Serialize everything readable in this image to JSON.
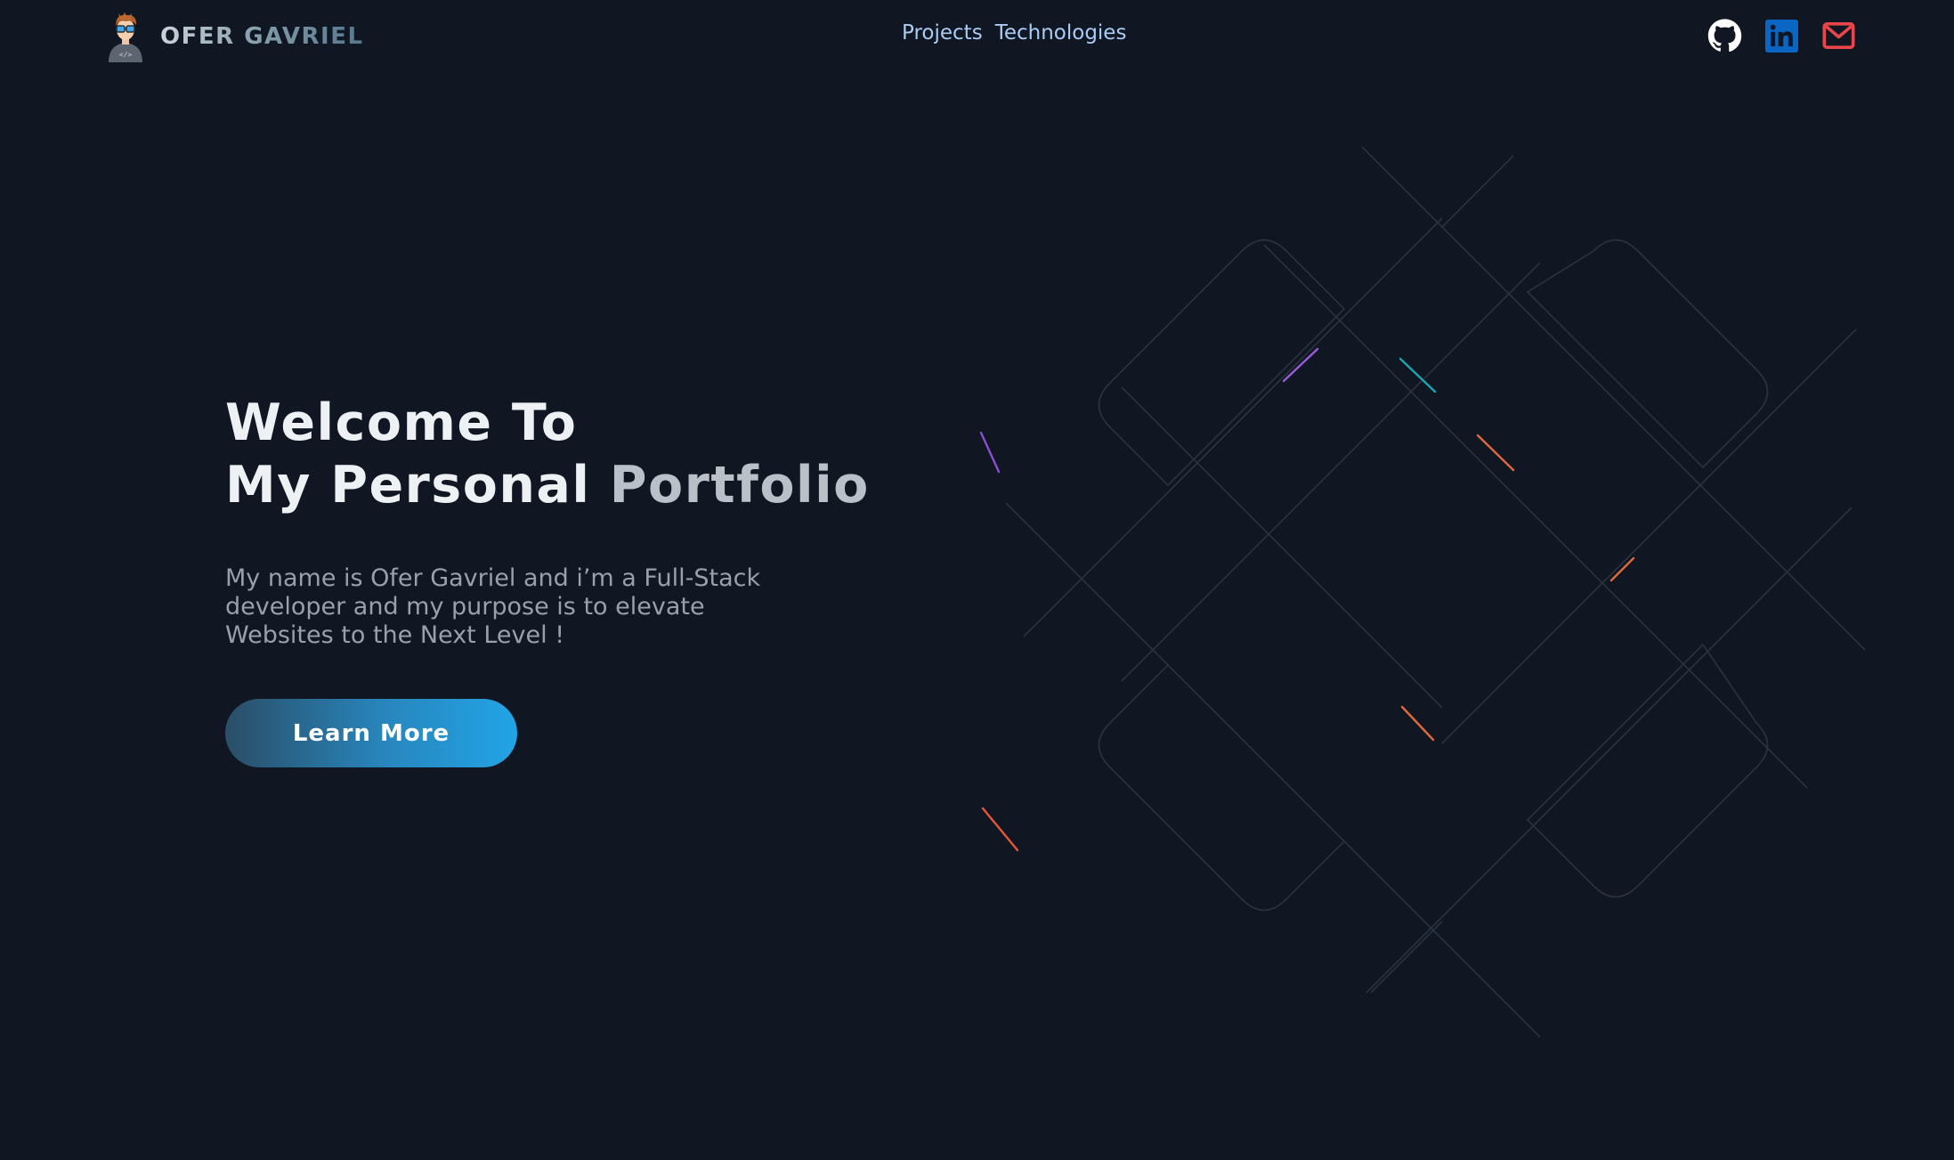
{
  "header": {
    "brand_name": "OFER GAVRIEL",
    "avatar_icon": "developer-avatar-icon",
    "nav": [
      {
        "label": "Projects"
      },
      {
        "label": "Technologies"
      }
    ],
    "socials": [
      {
        "icon": "github-icon",
        "color": "#ffffff"
      },
      {
        "icon": "linkedin-icon",
        "color": "#0a66c2"
      },
      {
        "icon": "mail-icon",
        "color": "#e8464a"
      }
    ]
  },
  "hero": {
    "title_line1": "Welcome To",
    "title_line2_a": "My Personal ",
    "title_line2_b": "Portfolio",
    "subtitle": "My name is Ofer Gavriel and i’m a Full-Stack developer and my purpose is to elevate Websites to the Next Level !",
    "cta_label": "Learn More"
  },
  "colors": {
    "background": "#101723",
    "nav_link": "#aacbf4",
    "cta_gradient_start": "#2a4e67",
    "cta_gradient_end": "#22a4e6"
  }
}
